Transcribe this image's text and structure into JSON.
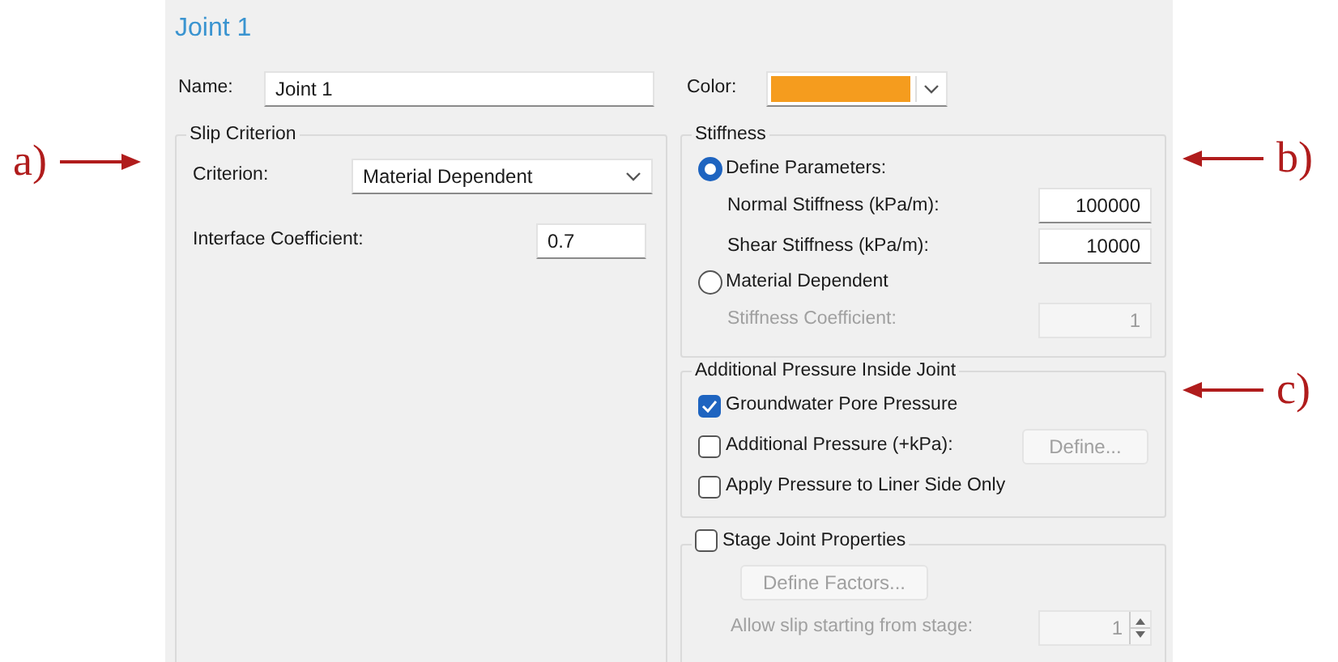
{
  "annotations_left": [
    {
      "label": "a)"
    }
  ],
  "annotations_right": [
    {
      "label": "b)"
    },
    {
      "label": "c)"
    }
  ],
  "dialog": {
    "title": "Joint 1",
    "name": {
      "label": "Name:",
      "value": "Joint 1"
    },
    "color": {
      "label": "Color:",
      "color": "#f59c1e"
    },
    "slip_criterion": {
      "title": "Slip Criterion",
      "criterion": {
        "label": "Criterion:",
        "value": "Material Dependent"
      },
      "interface_coefficient": {
        "label": "Interface Coefficient:",
        "value": "0.7"
      }
    },
    "stiffness": {
      "title": "Stiffness",
      "options": [
        {
          "label": "Define Parameters:",
          "selected": true,
          "fields": [
            {
              "label": "Normal Stiffness (kPa/m):",
              "value": "100000"
            },
            {
              "label": "Shear Stiffness (kPa/m):",
              "value": "10000"
            }
          ]
        },
        {
          "label": "Material Dependent",
          "selected": false,
          "fields": [
            {
              "label": "Stiffness Coefficient:",
              "value": "1"
            }
          ]
        }
      ]
    },
    "additional_pressure": {
      "title": "Additional Pressure Inside Joint",
      "items": [
        {
          "label": "Groundwater Pore Pressure",
          "checked": true
        },
        {
          "label": "Additional Pressure (+kPa):",
          "checked": false,
          "button": {
            "label": "Define...",
            "disabled": true
          }
        },
        {
          "label": "Apply Pressure to Liner Side Only",
          "checked": false
        }
      ]
    },
    "stage": {
      "label": "Stage Joint Properties",
      "checked": false,
      "button": {
        "label": "Define Factors...",
        "disabled": true
      },
      "stage_field": {
        "label": "Allow slip starting from stage:",
        "value": "1",
        "disabled": true
      }
    }
  }
}
